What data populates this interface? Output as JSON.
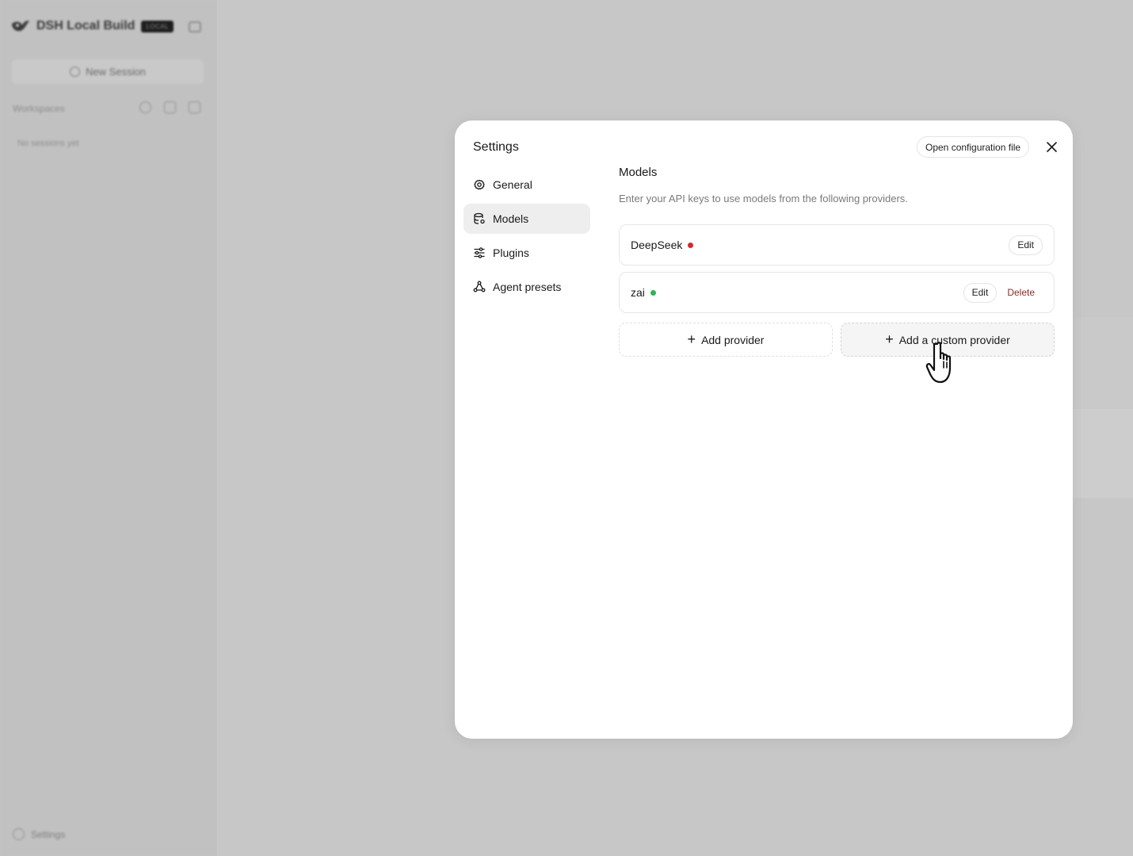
{
  "app": {
    "name": "DSH Local Build",
    "badge": "LOCAL",
    "new_session_label": "New Session",
    "workspaces_label": "Workspaces",
    "no_sessions_text": "No sessions yet",
    "settings_label": "Settings"
  },
  "modal": {
    "title": "Settings",
    "open_config_label": "Open configuration file",
    "nav": [
      {
        "label": "General",
        "icon": "gear-icon",
        "active": false
      },
      {
        "label": "Models",
        "icon": "database-icon",
        "active": true
      },
      {
        "label": "Plugins",
        "icon": "sliders-icon",
        "active": false
      },
      {
        "label": "Agent presets",
        "icon": "nodes-icon",
        "active": false
      }
    ],
    "section": {
      "title": "Models",
      "description": "Enter your API keys to use models from the following providers."
    },
    "providers": [
      {
        "name": "DeepSeek",
        "status_color": "#d9262b",
        "edit_label": "Edit"
      },
      {
        "name": "zai",
        "status_color": "#2fb35a",
        "edit_label": "Edit",
        "delete_label": "Delete"
      }
    ],
    "add_provider_label": "Add provider",
    "add_custom_provider_label": "Add a custom provider"
  }
}
